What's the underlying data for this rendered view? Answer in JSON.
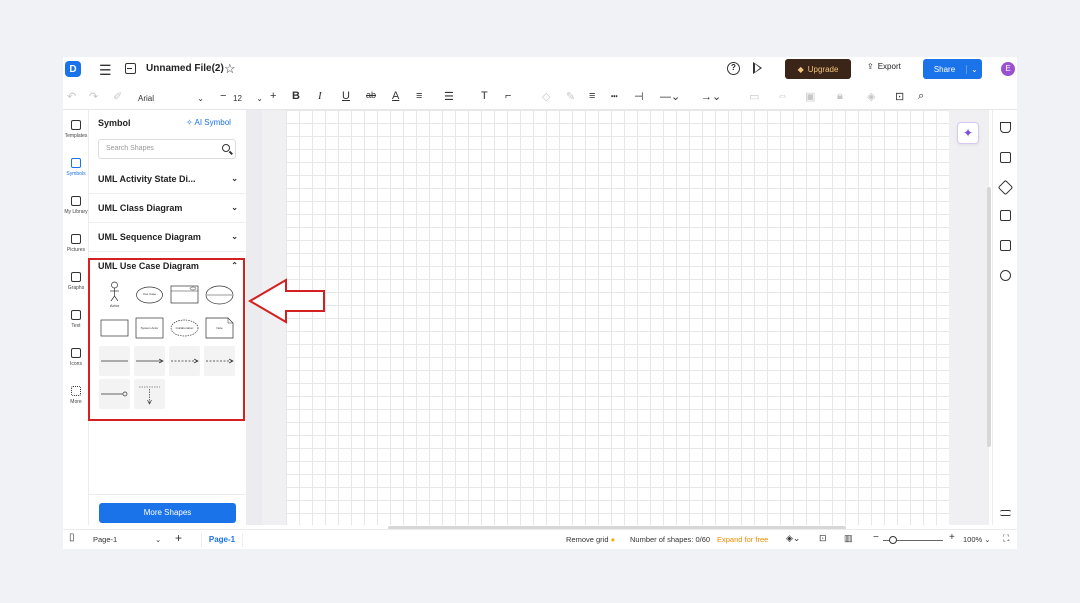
{
  "header": {
    "logo": "D",
    "file_name": "Unnamed File(2)",
    "upgrade_label": "Upgrade",
    "export_label": "Export",
    "share_label": "Share",
    "avatar_letter": "E"
  },
  "toolbar": {
    "font": "Arial",
    "font_size": "12"
  },
  "rail": {
    "items": [
      {
        "label": "Templates"
      },
      {
        "label": "Symbols"
      },
      {
        "label": "My Library"
      },
      {
        "label": "Pictures"
      },
      {
        "label": "Graphs"
      },
      {
        "label": "Text"
      },
      {
        "label": "Icons"
      },
      {
        "label": "More"
      }
    ]
  },
  "panel": {
    "title": "Symbol",
    "ai_symbol": "AI Symbol",
    "search_placeholder": "Search Shapes",
    "categories": [
      {
        "label": "UML Activity State Di..."
      },
      {
        "label": "UML Class Diagram"
      },
      {
        "label": "UML Sequence Diagram"
      },
      {
        "label": "UML Use Case Diagram"
      }
    ],
    "shape_labels": {
      "actor": "Actor",
      "use_case": "Use Case",
      "system_actor": "System Actor",
      "collaboration": "Collaboration",
      "note": "Note"
    },
    "more_shapes": "More Shapes"
  },
  "status": {
    "page_select": "Page-1",
    "page_tab": "Page-1",
    "remove_grid": "Remove grid",
    "shape_count": "Number of shapes: 0/60",
    "expand": "Expand for free",
    "zoom": "100%"
  },
  "colors": {
    "accent": "#1a73e8",
    "highlight": "#d42020",
    "upgrade_bg": "#3b2519",
    "expand": "#f08c00"
  }
}
